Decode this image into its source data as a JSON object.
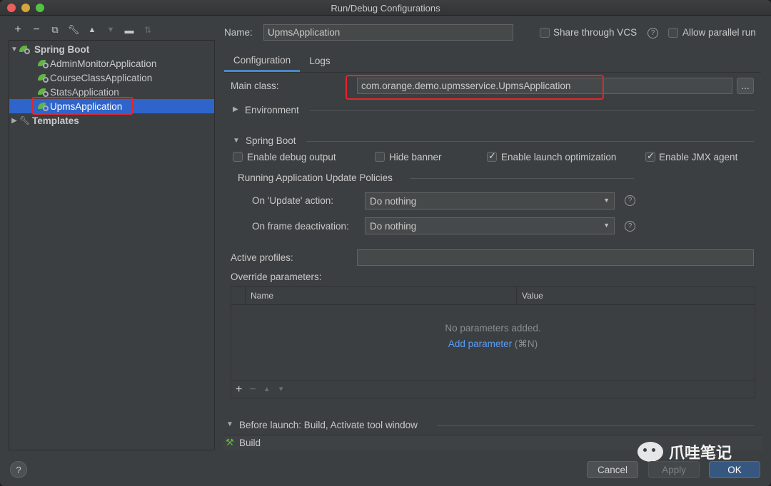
{
  "window": {
    "title": "Run/Debug Configurations"
  },
  "toolbar": {
    "icons": [
      "plus-icon",
      "minus-icon",
      "copy-icon",
      "wrench-icon",
      "arrow-up-icon",
      "arrow-down-icon",
      "folder-icon",
      "sort-icon"
    ]
  },
  "tree": {
    "group_label": "Spring Boot",
    "items": [
      {
        "label": "AdminMonitorApplication"
      },
      {
        "label": "CourseClassApplication"
      },
      {
        "label": "StatsApplication"
      },
      {
        "label": "UpmsApplication"
      }
    ],
    "templates_label": "Templates"
  },
  "header": {
    "name_label": "Name:",
    "name_value": "UpmsApplication",
    "share_vcs_label": "Share through VCS",
    "allow_parallel_label": "Allow parallel run"
  },
  "tabs": [
    {
      "label": "Configuration",
      "active": true
    },
    {
      "label": "Logs",
      "active": false
    }
  ],
  "config": {
    "main_class_label": "Main class:",
    "main_class_value": "com.orange.demo.upmsservice.UpmsApplication",
    "browse_label": "...",
    "environment_label": "Environment",
    "spring_boot_label": "Spring Boot",
    "enable_debug_label": "Enable debug output",
    "hide_banner_label": "Hide banner",
    "enable_launch_label": "Enable launch optimization",
    "enable_jmx_label": "Enable JMX agent",
    "policies_label": "Running Application Update Policies",
    "update_action_label": "On 'Update' action:",
    "update_action_value": "Do nothing",
    "frame_deactivation_label": "On frame deactivation:",
    "frame_deactivation_value": "Do nothing",
    "active_profiles_label": "Active profiles:",
    "active_profiles_value": "",
    "override_label": "Override parameters:",
    "table_name_header": "Name",
    "table_value_header": "Value",
    "empty_text": "No parameters added.",
    "add_param_label": "Add parameter",
    "add_param_shortcut": "(⌘N)"
  },
  "before_launch": {
    "label": "Before launch: Build, Activate tool window",
    "build_label": "Build"
  },
  "watermark": {
    "text": "爪哇笔记"
  },
  "footer": {
    "help_label": "?",
    "cancel_label": "Cancel",
    "apply_label": "Apply",
    "ok_label": "OK"
  },
  "colors": {
    "accent": "#2f65ca",
    "highlight_box": "#e8242b",
    "link": "#589df6"
  }
}
